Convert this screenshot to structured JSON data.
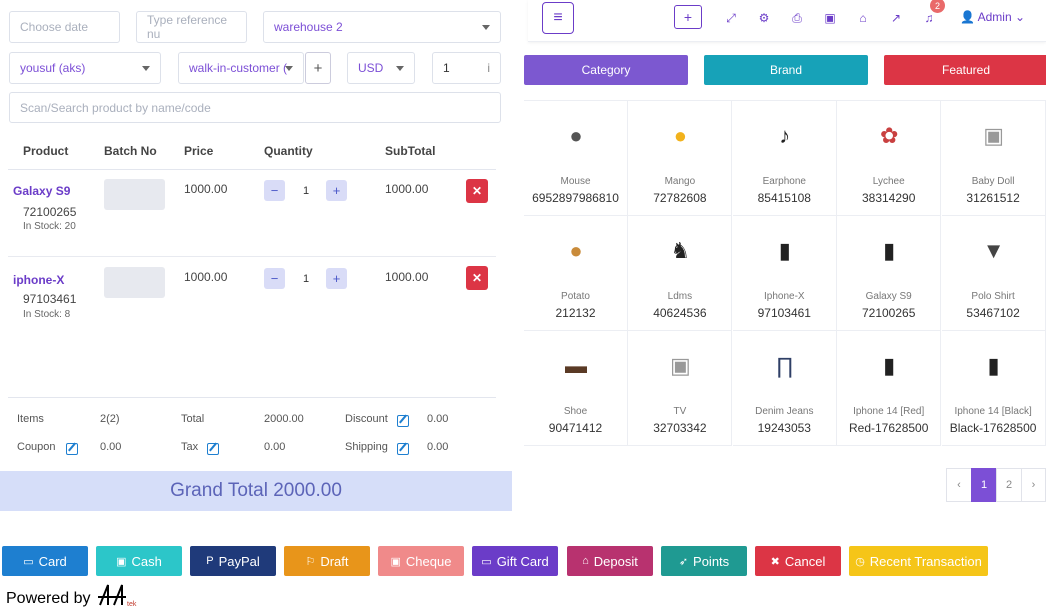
{
  "filters": {
    "date_placeholder": "Choose date",
    "reference_placeholder": "Type reference nu",
    "warehouse": "warehouse 2",
    "biller": "yousuf (aks)",
    "customer": "walk-in-customer (",
    "currency": "USD",
    "exchange_rate": "1",
    "scan_placeholder": "Scan/Search product by name/code"
  },
  "table": {
    "headers": [
      "Product",
      "Batch No",
      "Price",
      "Quantity",
      "SubTotal"
    ],
    "rows": [
      {
        "name": "Galaxy S9",
        "code": "72100265",
        "stock": "In Stock: 20",
        "price": "1000.00",
        "qty": "1",
        "subtotal": "1000.00"
      },
      {
        "name": "iphone-X",
        "code": "97103461",
        "stock": "In Stock: 8",
        "price": "1000.00",
        "qty": "1",
        "subtotal": "1000.00"
      }
    ]
  },
  "totals": {
    "items_label": "Items",
    "items_value": "2(2)",
    "total_label": "Total",
    "total_value": "2000.00",
    "discount_label": "Discount",
    "discount_value": "0.00",
    "coupon_label": "Coupon",
    "coupon_value": "0.00",
    "tax_label": "Tax",
    "tax_value": "0.00",
    "shipping_label": "Shipping",
    "shipping_value": "0.00",
    "grand_total": "Grand Total 2000.00"
  },
  "topbar": {
    "notification_count": "2",
    "user": "Admin"
  },
  "filter_tabs": [
    {
      "label": "Category",
      "color": "#7c58d0"
    },
    {
      "label": "Brand",
      "color": "#17a2b8"
    },
    {
      "label": "Featured",
      "color": "#dc3545"
    }
  ],
  "products": [
    {
      "name": "Mouse",
      "code": "6952897986810",
      "icon": "mouse-icon"
    },
    {
      "name": "Mango",
      "code": "72782608",
      "icon": "mango-icon"
    },
    {
      "name": "Earphone",
      "code": "85415108",
      "icon": "earphone-icon"
    },
    {
      "name": "Lychee",
      "code": "38314290",
      "icon": "lychee-icon"
    },
    {
      "name": "Baby Doll",
      "code": "31261512",
      "icon": "placeholder-image-icon"
    },
    {
      "name": "Potato",
      "code": "212132",
      "icon": "potato-icon"
    },
    {
      "name": "Ldms",
      "code": "40624536",
      "icon": "lion-logo-icon"
    },
    {
      "name": "Iphone-X",
      "code": "97103461",
      "icon": "phone-icon"
    },
    {
      "name": "Galaxy S9",
      "code": "72100265",
      "icon": "phone-icon"
    },
    {
      "name": "Polo Shirt",
      "code": "53467102",
      "icon": "shirt-icon"
    },
    {
      "name": "Shoe",
      "code": "90471412",
      "icon": "shoe-icon"
    },
    {
      "name": "TV",
      "code": "32703342",
      "icon": "placeholder-image-icon"
    },
    {
      "name": "Denim Jeans",
      "code": "19243053",
      "icon": "jeans-icon"
    },
    {
      "name": "Iphone 14 [Red]",
      "code": "Red-17628500",
      "icon": "phone-icon"
    },
    {
      "name": "Iphone 14 [Black]",
      "code": "Black-17628500",
      "icon": "phone-icon"
    }
  ],
  "pagination": {
    "prev": "‹",
    "pages": [
      "1",
      "2"
    ],
    "next": "›"
  },
  "payments": [
    {
      "label": "Card",
      "color": "#1e7fd0"
    },
    {
      "label": "Cash",
      "color": "#2cc6c9"
    },
    {
      "label": "PayPal",
      "color": "#1f3a7a"
    },
    {
      "label": "Draft",
      "color": "#e8951a"
    },
    {
      "label": "Cheque",
      "color": "#f08a8a"
    },
    {
      "label": "Gift Card",
      "color": "#6b3cc8"
    },
    {
      "label": "Deposit",
      "color": "#b8326f"
    },
    {
      "label": "Points",
      "color": "#1f9a92"
    },
    {
      "label": "Cancel",
      "color": "#dc3545"
    },
    {
      "label": "Recent Transaction",
      "color": "#f5c518"
    }
  ],
  "footer": {
    "powered_by": "Powered by",
    "logo_text": "tek"
  }
}
